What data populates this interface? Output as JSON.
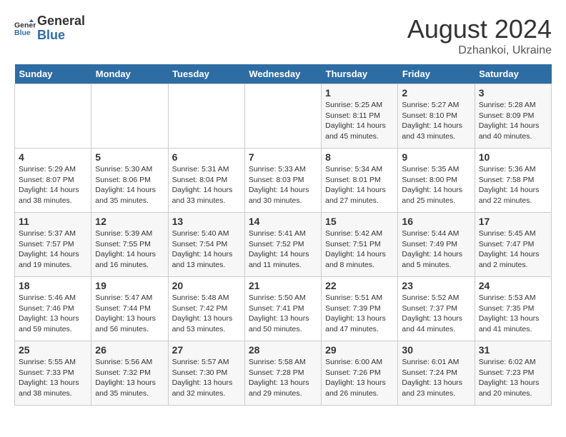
{
  "header": {
    "logo_line1": "General",
    "logo_line2": "Blue",
    "month_year": "August 2024",
    "location": "Dzhankoi, Ukraine"
  },
  "days_of_week": [
    "Sunday",
    "Monday",
    "Tuesday",
    "Wednesday",
    "Thursday",
    "Friday",
    "Saturday"
  ],
  "weeks": [
    [
      {
        "day": "",
        "info": ""
      },
      {
        "day": "",
        "info": ""
      },
      {
        "day": "",
        "info": ""
      },
      {
        "day": "",
        "info": ""
      },
      {
        "day": "1",
        "info": "Sunrise: 5:25 AM\nSunset: 8:11 PM\nDaylight: 14 hours\nand 45 minutes."
      },
      {
        "day": "2",
        "info": "Sunrise: 5:27 AM\nSunset: 8:10 PM\nDaylight: 14 hours\nand 43 minutes."
      },
      {
        "day": "3",
        "info": "Sunrise: 5:28 AM\nSunset: 8:09 PM\nDaylight: 14 hours\nand 40 minutes."
      }
    ],
    [
      {
        "day": "4",
        "info": "Sunrise: 5:29 AM\nSunset: 8:07 PM\nDaylight: 14 hours\nand 38 minutes."
      },
      {
        "day": "5",
        "info": "Sunrise: 5:30 AM\nSunset: 8:06 PM\nDaylight: 14 hours\nand 35 minutes."
      },
      {
        "day": "6",
        "info": "Sunrise: 5:31 AM\nSunset: 8:04 PM\nDaylight: 14 hours\nand 33 minutes."
      },
      {
        "day": "7",
        "info": "Sunrise: 5:33 AM\nSunset: 8:03 PM\nDaylight: 14 hours\nand 30 minutes."
      },
      {
        "day": "8",
        "info": "Sunrise: 5:34 AM\nSunset: 8:01 PM\nDaylight: 14 hours\nand 27 minutes."
      },
      {
        "day": "9",
        "info": "Sunrise: 5:35 AM\nSunset: 8:00 PM\nDaylight: 14 hours\nand 25 minutes."
      },
      {
        "day": "10",
        "info": "Sunrise: 5:36 AM\nSunset: 7:58 PM\nDaylight: 14 hours\nand 22 minutes."
      }
    ],
    [
      {
        "day": "11",
        "info": "Sunrise: 5:37 AM\nSunset: 7:57 PM\nDaylight: 14 hours\nand 19 minutes."
      },
      {
        "day": "12",
        "info": "Sunrise: 5:39 AM\nSunset: 7:55 PM\nDaylight: 14 hours\nand 16 minutes."
      },
      {
        "day": "13",
        "info": "Sunrise: 5:40 AM\nSunset: 7:54 PM\nDaylight: 14 hours\nand 13 minutes."
      },
      {
        "day": "14",
        "info": "Sunrise: 5:41 AM\nSunset: 7:52 PM\nDaylight: 14 hours\nand 11 minutes."
      },
      {
        "day": "15",
        "info": "Sunrise: 5:42 AM\nSunset: 7:51 PM\nDaylight: 14 hours\nand 8 minutes."
      },
      {
        "day": "16",
        "info": "Sunrise: 5:44 AM\nSunset: 7:49 PM\nDaylight: 14 hours\nand 5 minutes."
      },
      {
        "day": "17",
        "info": "Sunrise: 5:45 AM\nSunset: 7:47 PM\nDaylight: 14 hours\nand 2 minutes."
      }
    ],
    [
      {
        "day": "18",
        "info": "Sunrise: 5:46 AM\nSunset: 7:46 PM\nDaylight: 13 hours\nand 59 minutes."
      },
      {
        "day": "19",
        "info": "Sunrise: 5:47 AM\nSunset: 7:44 PM\nDaylight: 13 hours\nand 56 minutes."
      },
      {
        "day": "20",
        "info": "Sunrise: 5:48 AM\nSunset: 7:42 PM\nDaylight: 13 hours\nand 53 minutes."
      },
      {
        "day": "21",
        "info": "Sunrise: 5:50 AM\nSunset: 7:41 PM\nDaylight: 13 hours\nand 50 minutes."
      },
      {
        "day": "22",
        "info": "Sunrise: 5:51 AM\nSunset: 7:39 PM\nDaylight: 13 hours\nand 47 minutes."
      },
      {
        "day": "23",
        "info": "Sunrise: 5:52 AM\nSunset: 7:37 PM\nDaylight: 13 hours\nand 44 minutes."
      },
      {
        "day": "24",
        "info": "Sunrise: 5:53 AM\nSunset: 7:35 PM\nDaylight: 13 hours\nand 41 minutes."
      }
    ],
    [
      {
        "day": "25",
        "info": "Sunrise: 5:55 AM\nSunset: 7:33 PM\nDaylight: 13 hours\nand 38 minutes."
      },
      {
        "day": "26",
        "info": "Sunrise: 5:56 AM\nSunset: 7:32 PM\nDaylight: 13 hours\nand 35 minutes."
      },
      {
        "day": "27",
        "info": "Sunrise: 5:57 AM\nSunset: 7:30 PM\nDaylight: 13 hours\nand 32 minutes."
      },
      {
        "day": "28",
        "info": "Sunrise: 5:58 AM\nSunset: 7:28 PM\nDaylight: 13 hours\nand 29 minutes."
      },
      {
        "day": "29",
        "info": "Sunrise: 6:00 AM\nSunset: 7:26 PM\nDaylight: 13 hours\nand 26 minutes."
      },
      {
        "day": "30",
        "info": "Sunrise: 6:01 AM\nSunset: 7:24 PM\nDaylight: 13 hours\nand 23 minutes."
      },
      {
        "day": "31",
        "info": "Sunrise: 6:02 AM\nSunset: 7:23 PM\nDaylight: 13 hours\nand 20 minutes."
      }
    ]
  ]
}
